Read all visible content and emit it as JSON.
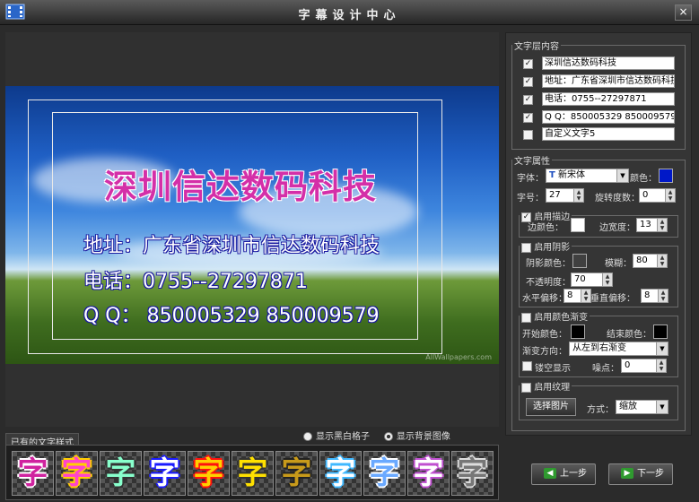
{
  "window": {
    "title": "字幕设计中心",
    "close": "×"
  },
  "preview": {
    "lines": [
      "深圳信达数码科技",
      "地址：广东省深圳市信达数码科技",
      "电话：0755--27297871",
      "Q Q： 850005329   850009579"
    ],
    "watermark": "AllWallpapers.com"
  },
  "options": {
    "show_bw_grid": "显示黑白格子",
    "show_bg_image": "显示背景图像"
  },
  "styles": {
    "label": "已有的文字样式",
    "glyph": "字",
    "colors": [
      [
        "#d0239f",
        "#ffffff"
      ],
      [
        "#ff44cc",
        "#ffd000"
      ],
      [
        "#88ffcc",
        "#333333"
      ],
      [
        "#ffffff",
        "#1a1aff"
      ],
      [
        "#ffd000",
        "#ff1010"
      ],
      [
        "#ffe000",
        "#333333"
      ],
      [
        "#c89a1a",
        "#222222"
      ],
      [
        "#ffffff",
        "#40b8ff"
      ],
      [
        "#6aa9ff",
        "#ffffff"
      ],
      [
        "#ffffff",
        "#c050d0"
      ],
      [
        "#777777",
        "#dddddd"
      ]
    ]
  },
  "nav": {
    "prev": "上一步",
    "next": "下一步"
  },
  "layers": {
    "title": "文字层内容",
    "items": [
      {
        "text": "深圳信达数码科技",
        "checked": "✓"
      },
      {
        "text": "地址：广东省深圳市信达数码科技",
        "checked": "✓"
      },
      {
        "text": "电话：0755--27297871",
        "checked": "✓"
      },
      {
        "text": "Q Q：850005329  850009579",
        "checked": "✓"
      },
      {
        "text": "自定义文字5",
        "checked": ""
      }
    ]
  },
  "attrs": {
    "title": "文字属性",
    "font_label": "字体：",
    "font_value": "新宋体",
    "color_label": "颜色：",
    "font_color": "#0018c8",
    "size_label": "字号：",
    "size_value": "27",
    "rotate_label": "旋转度数：",
    "rotate_value": "0"
  },
  "stroke": {
    "title": "启用描边",
    "checked": "✓",
    "color_label": "边颜色：",
    "color": "#ffffff",
    "width_label": "边宽度：",
    "width_value": "13"
  },
  "shadow": {
    "title": "启用阴影",
    "checked": "",
    "color_label": "阴影颜色：",
    "color": "#404040",
    "blur_label": "模糊：",
    "blur_value": "80",
    "opacity_label": "不透明度：",
    "opacity_value": "70",
    "hoff_label": "水平偏移：",
    "hoff_value": "8",
    "voff_label": "垂直偏移：",
    "voff_value": "8"
  },
  "gradient": {
    "title": "启用颜色渐变",
    "checked": "",
    "start_label": "开始颜色：",
    "start_color": "#000000",
    "end_label": "结束颜色：",
    "end_color": "#000000",
    "dir_label": "渐变方向：",
    "dir_value": "从左到右渐变",
    "hollow_label": "镂空显示",
    "hollow_checked": "",
    "dots_label": "噪点：",
    "dots_value": "0"
  },
  "texture": {
    "title": "启用纹理",
    "checked": "",
    "choose_label": "选择图片",
    "mode_label": "方式：",
    "mode_value": "缩放"
  }
}
